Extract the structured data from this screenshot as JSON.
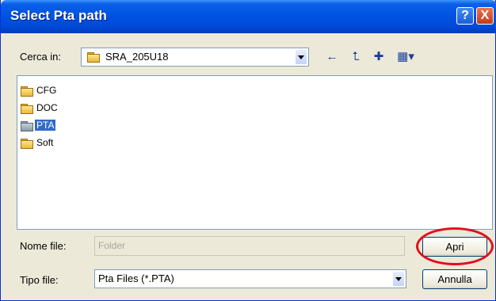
{
  "window": {
    "title": "Select Pta path"
  },
  "titlebar": {
    "help": "?",
    "close": "X"
  },
  "lookin": {
    "label": "Cerca in:",
    "value": "SRA_205U18"
  },
  "files": [
    {
      "name": "CFG",
      "selected": false
    },
    {
      "name": "DOC",
      "selected": false
    },
    {
      "name": "PTA",
      "selected": true
    },
    {
      "name": "Soft",
      "selected": false
    }
  ],
  "filename": {
    "label": "Nome file:",
    "placeholder": "Folder"
  },
  "filetype": {
    "label": "Tipo file:",
    "value": "Pta Files (*.PTA)"
  },
  "buttons": {
    "open": "Apri",
    "cancel": "Annulla"
  },
  "toolbar": {
    "back": "←",
    "up": "⮤",
    "new_folder": "✚",
    "view": "▦▾"
  },
  "colors": {
    "titlebar": "#0054e3",
    "selection": "#316ac5",
    "highlight_circle": "#e0101a"
  }
}
